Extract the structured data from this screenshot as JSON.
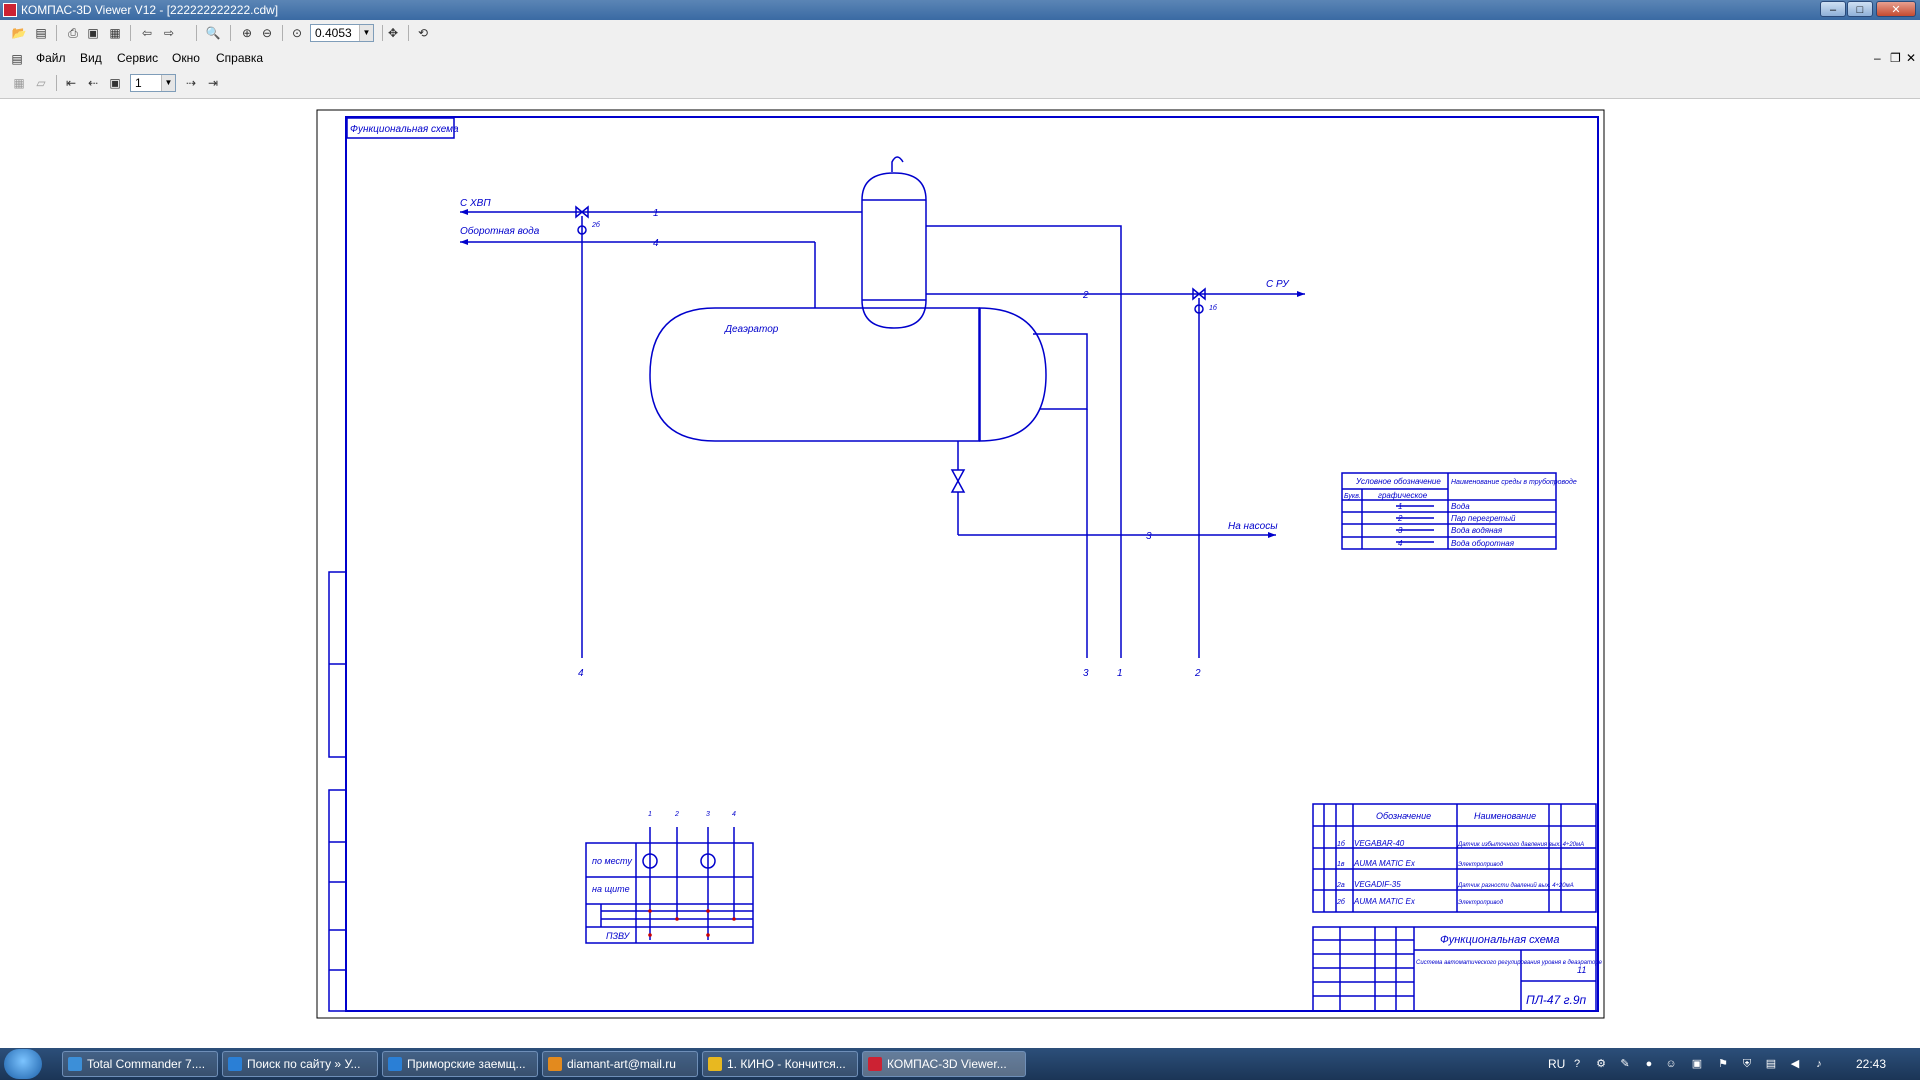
{
  "window": {
    "title": "КОМПАС-3D Viewer V12 - [222222222222.cdw]"
  },
  "toolbar": {
    "zoom_value": "0.4053",
    "layer_value": "1"
  },
  "menu": {
    "items": [
      "Файл",
      "Вид",
      "Сервис",
      "Окно",
      "Справка"
    ]
  },
  "drawing": {
    "corner_label": "Функциональная схема",
    "deaerator_label": "Деаэратор",
    "line_labels": {
      "from_hvp": "С ХВП",
      "return_water": "Оборотная вода",
      "from_ru": "С РУ",
      "to_pumps": "На насосы",
      "n1": "1",
      "n4": "4",
      "n2": "2",
      "n3": "3"
    },
    "instrument_tags": {
      "left": "2б",
      "right": "1б"
    },
    "bottom_numbers": [
      "4",
      "3",
      "1",
      "2"
    ],
    "legend": {
      "header_left": "Условное обозначение",
      "header_sub_left": "Букв.",
      "header_sub_mid": "графическое",
      "header_right": "Наименование среды в трубопроводе",
      "rows": [
        {
          "num": "1",
          "name": "Вода"
        },
        {
          "num": "2",
          "name": "Пар перегретый"
        },
        {
          "num": "3",
          "name": "Вода водяная"
        },
        {
          "num": "4",
          "name": "Вода оборотная"
        }
      ]
    },
    "spec": {
      "headers": [
        "Обозначение",
        "Наименование"
      ],
      "rows": [
        {
          "pos": "1б",
          "code": "VEGABAR-40",
          "name": "Датчик избыточного давления вых. 4÷20мА"
        },
        {
          "pos": "1в",
          "code": "AUMA MATIC Ex",
          "name": "Электропривод"
        },
        {
          "pos": "2а",
          "code": "VEGADIF-35",
          "name": "Датчик разности давлений вых. 4÷20мА"
        },
        {
          "pos": "2б",
          "code": "AUMA MATIC Ex",
          "name": "Электропривод"
        }
      ]
    },
    "panel": {
      "row_labels": [
        "по месту",
        "на щите",
        "ПЗВУ"
      ],
      "top_numbers": [
        "1",
        "2",
        "3",
        "4"
      ]
    },
    "title_block": {
      "title": "Функциональная схема",
      "subtitle": "Система автоматического регулирования уровня в деаэраторе",
      "sheet_number": "11",
      "code": "ПЛ-47 г.9п"
    }
  },
  "taskbar": {
    "items": [
      "Total Commander 7....",
      "Поиск по сайту » У...",
      "Приморские заемщ...",
      "diamant-art@mail.ru",
      "1. КИНО - Кончится...",
      "КОМПАС-3D Viewer..."
    ],
    "lang": "RU",
    "clock": "22:43"
  }
}
